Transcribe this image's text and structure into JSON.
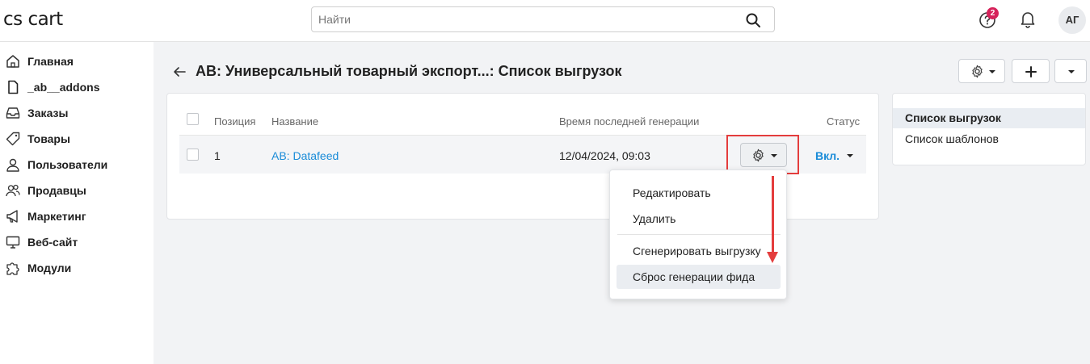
{
  "app": {
    "logo": "cs cart"
  },
  "search": {
    "placeholder": "Найти"
  },
  "header": {
    "help_badge": "2",
    "avatar_initials": "АГ"
  },
  "sidebar": {
    "items": [
      {
        "label": "Главная",
        "icon": "home-icon"
      },
      {
        "label": "_ab__addons",
        "icon": "file-icon"
      },
      {
        "label": "Заказы",
        "icon": "inbox-icon"
      },
      {
        "label": "Товары",
        "icon": "tag-icon"
      },
      {
        "label": "Пользователи",
        "icon": "user-icon"
      },
      {
        "label": "Продавцы",
        "icon": "users-icon"
      },
      {
        "label": "Маркетинг",
        "icon": "megaphone-icon"
      },
      {
        "label": "Веб-сайт",
        "icon": "monitor-icon"
      },
      {
        "label": "Модули",
        "icon": "puzzle-icon"
      }
    ]
  },
  "page": {
    "title": "АВ: Универсальный товарный экспорт...: Список выгрузок"
  },
  "table": {
    "columns": {
      "position": "Позиция",
      "name": "Название",
      "last_gen": "Время последней генерации",
      "status": "Статус"
    },
    "rows": [
      {
        "position": "1",
        "name": "АВ: Datafeed",
        "last_gen": "12/04/2024, 09:03",
        "status": "Вкл."
      }
    ]
  },
  "dropdown": {
    "items": [
      {
        "label": "Редактировать"
      },
      {
        "label": "Удалить"
      },
      {
        "label": "Сгенерировать выгрузку"
      },
      {
        "label": "Сброс генерации фида"
      }
    ]
  },
  "side_menu": {
    "items": [
      {
        "label": "Список выгрузок",
        "active": true
      },
      {
        "label": "Список шаблонов",
        "active": false
      }
    ]
  },
  "colors": {
    "accent": "#1a8cd8",
    "highlight": "#e43d3d",
    "badge": "#d6225a"
  }
}
